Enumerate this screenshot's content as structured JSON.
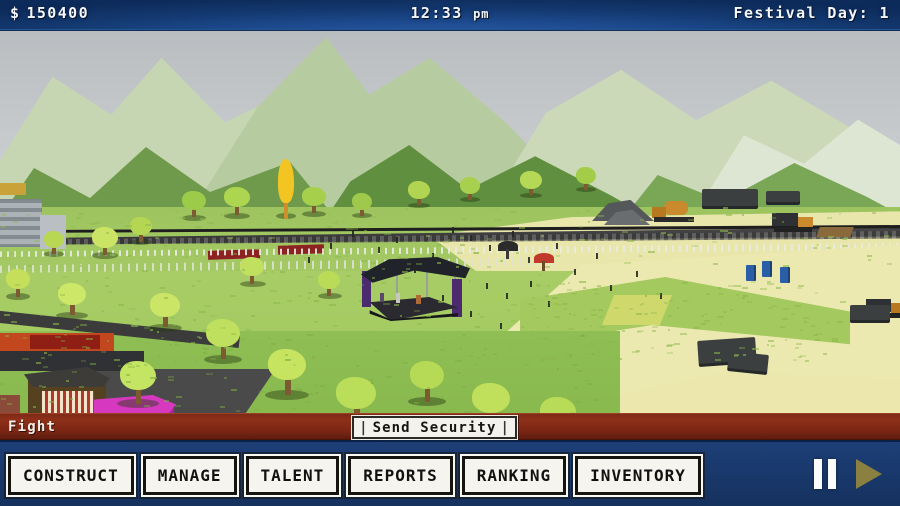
{
  "hud": {
    "money_symbol": "$",
    "money_value": "150400",
    "clock_time": "12:33",
    "clock_ampm": "pm",
    "festival_day_label": "Festival Day: 1"
  },
  "alert": {
    "event_label": "Fight",
    "action_label": "Send Security",
    "action_tick_left": "|",
    "action_tick_right": "|",
    "bar_color": "#8e3019"
  },
  "nav": {
    "buttons": [
      {
        "label": "CONSTRUCT",
        "name": "construct"
      },
      {
        "label": "MANAGE",
        "name": "manage"
      },
      {
        "label": "TALENT",
        "name": "talent"
      },
      {
        "label": "REPORTS",
        "name": "reports"
      },
      {
        "label": "RANKING",
        "name": "ranking"
      },
      {
        "label": "INVENTORY",
        "name": "inventory"
      }
    ]
  },
  "media": {
    "pause_icon": "pause-icon",
    "play_icon": "play-icon",
    "pause_state": "active",
    "play_state": "dimmed",
    "play_color": "#8a8040",
    "pause_color": "#fbfbfb"
  },
  "theme": {
    "hud_blue": "#1a4681",
    "bottom_blue": "#1a3a6e",
    "alert_red": "#8e3019",
    "grass_green": "#a9cd66",
    "sand_cream": "#ece9b0",
    "stage_purple": "#4b2a70"
  },
  "world": {
    "description": "isometric low-poly festival ground",
    "stage_name": "main-stage",
    "terrain": [
      "mountains",
      "railway",
      "grass-field",
      "sand-construction-area",
      "city-block"
    ]
  }
}
